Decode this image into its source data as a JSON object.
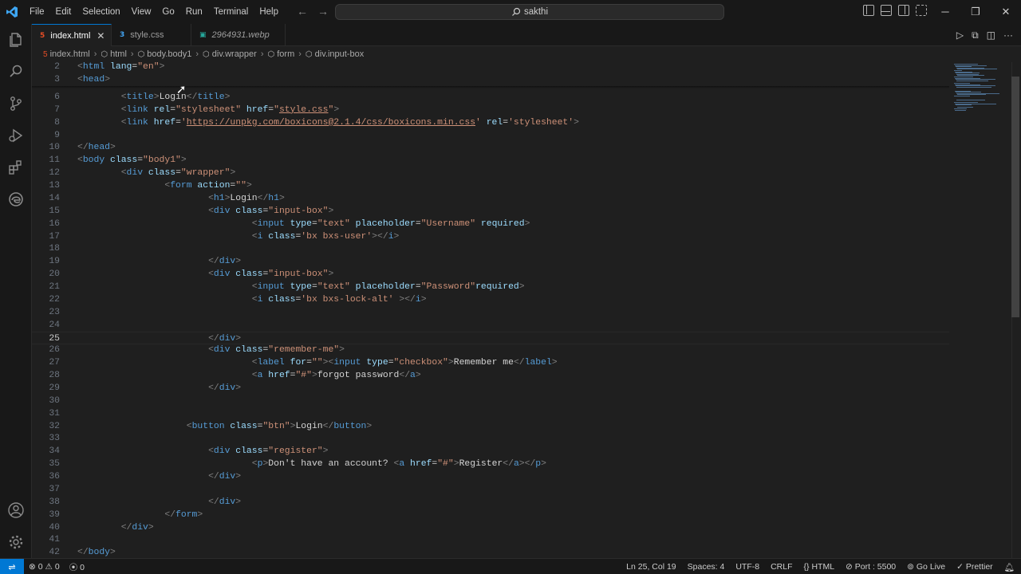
{
  "menu": [
    "File",
    "Edit",
    "Selection",
    "View",
    "Go",
    "Run",
    "Terminal",
    "Help"
  ],
  "search": {
    "label": "sakthi"
  },
  "tabs": [
    {
      "label": "index.html",
      "icon": "html-file-icon",
      "active": true
    },
    {
      "label": "style.css",
      "icon": "css-file-icon",
      "active": false
    },
    {
      "label": "2964931.webp",
      "icon": "image-file-icon",
      "active": false
    }
  ],
  "breadcrumb": [
    "index.html",
    "html",
    "body.body1",
    "div.wrapper",
    "form",
    "div.input-box"
  ],
  "editor": {
    "current_line": 25,
    "lines": [
      {
        "n": "2",
        "t": [
          [
            "b",
            "<"
          ],
          [
            "g",
            "html"
          ],
          [
            "a",
            " lang"
          ],
          [
            "p",
            "="
          ],
          [
            "s",
            "\"en\""
          ],
          [
            "b",
            ">"
          ]
        ]
      },
      {
        "n": "3",
        "t": [
          [
            "b",
            "<"
          ],
          [
            "g",
            "head"
          ],
          [
            "b",
            ">"
          ]
        ]
      },
      {
        "n": "6",
        "t": [
          [
            "p",
            "        "
          ],
          [
            "b",
            "<"
          ],
          [
            "g",
            "title"
          ],
          [
            "b",
            ">"
          ],
          [
            "p",
            "Login"
          ],
          [
            "b",
            "</"
          ],
          [
            "g",
            "title"
          ],
          [
            "b",
            ">"
          ]
        ]
      },
      {
        "n": "7",
        "t": [
          [
            "p",
            "        "
          ],
          [
            "b",
            "<"
          ],
          [
            "g",
            "link"
          ],
          [
            "a",
            " rel"
          ],
          [
            "p",
            "="
          ],
          [
            "s",
            "\"stylesheet\""
          ],
          [
            "a",
            " href"
          ],
          [
            "p",
            "="
          ],
          [
            "s",
            "\""
          ],
          [
            "l",
            "style.css"
          ],
          [
            "s",
            "\""
          ],
          [
            "b",
            ">"
          ]
        ]
      },
      {
        "n": "8",
        "t": [
          [
            "p",
            "        "
          ],
          [
            "b",
            "<"
          ],
          [
            "g",
            "link"
          ],
          [
            "a",
            " href"
          ],
          [
            "p",
            "="
          ],
          [
            "s",
            "'"
          ],
          [
            "l",
            "https://unpkg.com/boxicons@2.1.4/css/boxicons.min.css"
          ],
          [
            "s",
            "'"
          ],
          [
            "a",
            " rel"
          ],
          [
            "p",
            "="
          ],
          [
            "s",
            "'stylesheet'"
          ],
          [
            "b",
            ">"
          ]
        ]
      },
      {
        "n": "9",
        "t": []
      },
      {
        "n": "10",
        "t": [
          [
            "b",
            "</"
          ],
          [
            "g",
            "head"
          ],
          [
            "b",
            ">"
          ]
        ]
      },
      {
        "n": "11",
        "t": [
          [
            "b",
            "<"
          ],
          [
            "g",
            "body"
          ],
          [
            "a",
            " class"
          ],
          [
            "p",
            "="
          ],
          [
            "s",
            "\"body1\""
          ],
          [
            "b",
            ">"
          ]
        ]
      },
      {
        "n": "12",
        "t": [
          [
            "p",
            "        "
          ],
          [
            "b",
            "<"
          ],
          [
            "g",
            "div"
          ],
          [
            "a",
            " class"
          ],
          [
            "p",
            "="
          ],
          [
            "s",
            "\"wrapper\""
          ],
          [
            "b",
            ">"
          ]
        ]
      },
      {
        "n": "13",
        "t": [
          [
            "p",
            "                "
          ],
          [
            "b",
            "<"
          ],
          [
            "g",
            "form"
          ],
          [
            "a",
            " action"
          ],
          [
            "p",
            "="
          ],
          [
            "s",
            "\"\""
          ],
          [
            "b",
            ">"
          ]
        ]
      },
      {
        "n": "14",
        "t": [
          [
            "p",
            "                        "
          ],
          [
            "b",
            "<"
          ],
          [
            "g",
            "h1"
          ],
          [
            "b",
            ">"
          ],
          [
            "p",
            "Login"
          ],
          [
            "b",
            "</"
          ],
          [
            "g",
            "h1"
          ],
          [
            "b",
            ">"
          ]
        ]
      },
      {
        "n": "15",
        "t": [
          [
            "p",
            "                        "
          ],
          [
            "b",
            "<"
          ],
          [
            "g",
            "div"
          ],
          [
            "a",
            " class"
          ],
          [
            "p",
            "="
          ],
          [
            "s",
            "\"input-box\""
          ],
          [
            "b",
            ">"
          ]
        ]
      },
      {
        "n": "16",
        "t": [
          [
            "p",
            "                                "
          ],
          [
            "b",
            "<"
          ],
          [
            "g",
            "input"
          ],
          [
            "a",
            " type"
          ],
          [
            "p",
            "="
          ],
          [
            "s",
            "\"text\""
          ],
          [
            "a",
            " placeholder"
          ],
          [
            "p",
            "="
          ],
          [
            "s",
            "\"Username\""
          ],
          [
            "a",
            " required"
          ],
          [
            "b",
            ">"
          ]
        ]
      },
      {
        "n": "17",
        "t": [
          [
            "p",
            "                                "
          ],
          [
            "b",
            "<"
          ],
          [
            "g",
            "i"
          ],
          [
            "a",
            " class"
          ],
          [
            "p",
            "="
          ],
          [
            "s",
            "'bx bxs-user'"
          ],
          [
            "b",
            "></"
          ],
          [
            "g",
            "i"
          ],
          [
            "b",
            ">"
          ]
        ]
      },
      {
        "n": "18",
        "t": []
      },
      {
        "n": "19",
        "t": [
          [
            "p",
            "                        "
          ],
          [
            "b",
            "</"
          ],
          [
            "g",
            "div"
          ],
          [
            "b",
            ">"
          ]
        ]
      },
      {
        "n": "20",
        "t": [
          [
            "p",
            "                        "
          ],
          [
            "b",
            "<"
          ],
          [
            "g",
            "div"
          ],
          [
            "a",
            " class"
          ],
          [
            "p",
            "="
          ],
          [
            "s",
            "\"input-box\""
          ],
          [
            "b",
            ">"
          ]
        ]
      },
      {
        "n": "21",
        "t": [
          [
            "p",
            "                                "
          ],
          [
            "b",
            "<"
          ],
          [
            "g",
            "input"
          ],
          [
            "a",
            " type"
          ],
          [
            "p",
            "="
          ],
          [
            "s",
            "\"text\""
          ],
          [
            "a",
            " placeholder"
          ],
          [
            "p",
            "="
          ],
          [
            "s",
            "\"Password\""
          ],
          [
            "a",
            "required"
          ],
          [
            "b",
            ">"
          ]
        ]
      },
      {
        "n": "22",
        "t": [
          [
            "p",
            "                                "
          ],
          [
            "b",
            "<"
          ],
          [
            "g",
            "i"
          ],
          [
            "a",
            " class"
          ],
          [
            "p",
            "="
          ],
          [
            "s",
            "'bx bxs-lock-alt'"
          ],
          [
            "p",
            " "
          ],
          [
            "b",
            "></"
          ],
          [
            "g",
            "i"
          ],
          [
            "b",
            ">"
          ]
        ]
      },
      {
        "n": "23",
        "t": []
      },
      {
        "n": "24",
        "t": []
      },
      {
        "n": "25",
        "t": [
          [
            "p",
            "                        "
          ],
          [
            "b",
            "</"
          ],
          [
            "g",
            "div"
          ],
          [
            "b",
            ">"
          ]
        ]
      },
      {
        "n": "26",
        "t": [
          [
            "p",
            "                        "
          ],
          [
            "b",
            "<"
          ],
          [
            "g",
            "div"
          ],
          [
            "a",
            " class"
          ],
          [
            "p",
            "="
          ],
          [
            "s",
            "\"remember-me\""
          ],
          [
            "b",
            ">"
          ]
        ]
      },
      {
        "n": "27",
        "t": [
          [
            "p",
            "                                "
          ],
          [
            "b",
            "<"
          ],
          [
            "g",
            "label"
          ],
          [
            "a",
            " for"
          ],
          [
            "p",
            "="
          ],
          [
            "s",
            "\"\""
          ],
          [
            "b",
            "><"
          ],
          [
            "g",
            "input"
          ],
          [
            "a",
            " type"
          ],
          [
            "p",
            "="
          ],
          [
            "s",
            "\"checkbox\""
          ],
          [
            "b",
            ">"
          ],
          [
            "p",
            "Remember me"
          ],
          [
            "b",
            "</"
          ],
          [
            "g",
            "label"
          ],
          [
            "b",
            ">"
          ]
        ]
      },
      {
        "n": "28",
        "t": [
          [
            "p",
            "                                "
          ],
          [
            "b",
            "<"
          ],
          [
            "g",
            "a"
          ],
          [
            "a",
            " href"
          ],
          [
            "p",
            "="
          ],
          [
            "s",
            "\"#\""
          ],
          [
            "b",
            ">"
          ],
          [
            "p",
            "forgot password"
          ],
          [
            "b",
            "</"
          ],
          [
            "g",
            "a"
          ],
          [
            "b",
            ">"
          ]
        ]
      },
      {
        "n": "29",
        "t": [
          [
            "p",
            "                        "
          ],
          [
            "b",
            "</"
          ],
          [
            "g",
            "div"
          ],
          [
            "b",
            ">"
          ]
        ]
      },
      {
        "n": "30",
        "t": []
      },
      {
        "n": "31",
        "t": []
      },
      {
        "n": "32",
        "t": [
          [
            "p",
            "                    "
          ],
          [
            "b",
            "<"
          ],
          [
            "g",
            "button"
          ],
          [
            "a",
            " class"
          ],
          [
            "p",
            "="
          ],
          [
            "s",
            "\"btn\""
          ],
          [
            "b",
            ">"
          ],
          [
            "p",
            "Login"
          ],
          [
            "b",
            "</"
          ],
          [
            "g",
            "button"
          ],
          [
            "b",
            ">"
          ]
        ]
      },
      {
        "n": "33",
        "t": []
      },
      {
        "n": "34",
        "t": [
          [
            "p",
            "                        "
          ],
          [
            "b",
            "<"
          ],
          [
            "g",
            "div"
          ],
          [
            "a",
            " class"
          ],
          [
            "p",
            "="
          ],
          [
            "s",
            "\"register\""
          ],
          [
            "b",
            ">"
          ]
        ]
      },
      {
        "n": "35",
        "t": [
          [
            "p",
            "                                "
          ],
          [
            "b",
            "<"
          ],
          [
            "g",
            "p"
          ],
          [
            "b",
            ">"
          ],
          [
            "p",
            "Don't have an account? "
          ],
          [
            "b",
            "<"
          ],
          [
            "g",
            "a"
          ],
          [
            "a",
            " href"
          ],
          [
            "p",
            "="
          ],
          [
            "s",
            "\"#\""
          ],
          [
            "b",
            ">"
          ],
          [
            "p",
            "Register"
          ],
          [
            "b",
            "</"
          ],
          [
            "g",
            "a"
          ],
          [
            "b",
            "></"
          ],
          [
            "g",
            "p"
          ],
          [
            "b",
            ">"
          ]
        ]
      },
      {
        "n": "36",
        "t": [
          [
            "p",
            "                        "
          ],
          [
            "b",
            "</"
          ],
          [
            "g",
            "div"
          ],
          [
            "b",
            ">"
          ]
        ]
      },
      {
        "n": "37",
        "t": []
      },
      {
        "n": "38",
        "t": [
          [
            "p",
            "                        "
          ],
          [
            "b",
            "</"
          ],
          [
            "g",
            "div"
          ],
          [
            "b",
            ">"
          ]
        ]
      },
      {
        "n": "39",
        "t": [
          [
            "p",
            "                "
          ],
          [
            "b",
            "</"
          ],
          [
            "g",
            "form"
          ],
          [
            "b",
            ">"
          ]
        ]
      },
      {
        "n": "40",
        "t": [
          [
            "p",
            "        "
          ],
          [
            "b",
            "</"
          ],
          [
            "g",
            "div"
          ],
          [
            "b",
            ">"
          ]
        ]
      },
      {
        "n": "41",
        "t": []
      },
      {
        "n": "42",
        "t": [
          [
            "b",
            "</"
          ],
          [
            "g",
            "body"
          ],
          [
            "b",
            ">"
          ]
        ]
      }
    ]
  },
  "status": {
    "errors": "0",
    "warnings": "0",
    "ports": "0",
    "position": "Ln 25, Col 19",
    "spaces": "Spaces: 4",
    "encoding": "UTF-8",
    "eol": "CRLF",
    "language": "HTML",
    "port": "Port : 5500",
    "golive": "Go Live",
    "prettier": "Prettier"
  },
  "colors": {
    "accent": "#0078d4",
    "tag": "#569cd6",
    "attribute": "#9cdcfe",
    "string": "#ce9178",
    "text": "#d4d4d4",
    "bracket": "#808080"
  }
}
